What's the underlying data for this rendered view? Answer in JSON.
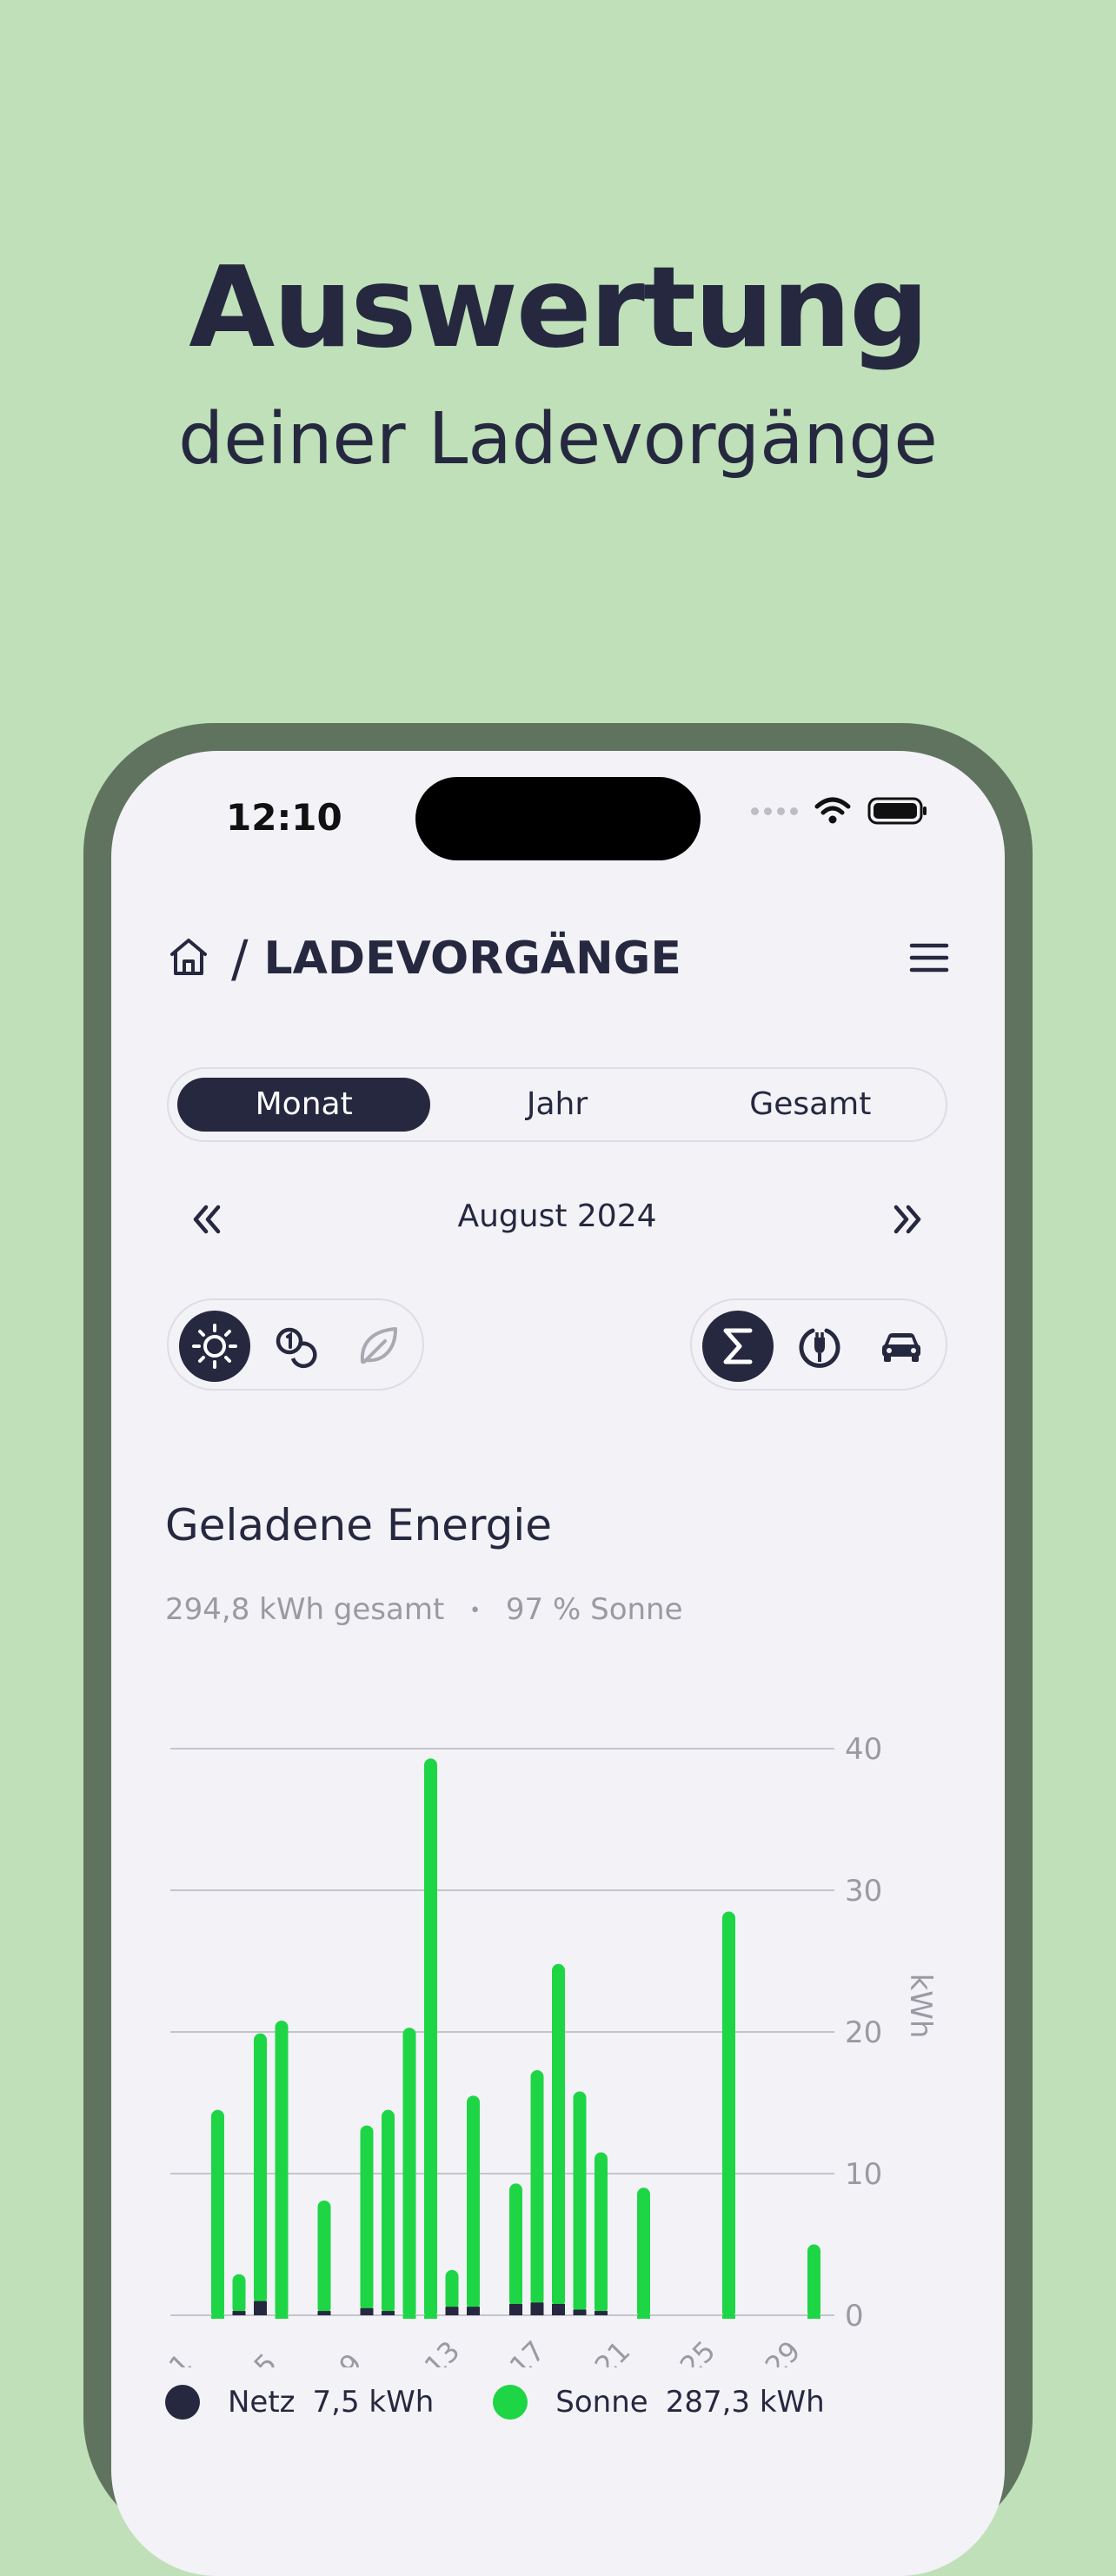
{
  "promo": {
    "headline": "Auswertung",
    "subline": "deiner Ladevorgänge"
  },
  "status_bar": {
    "time": "12:10"
  },
  "nav": {
    "home_icon": "home-icon",
    "separator": "/",
    "title": "LADEVORGÄNGE",
    "menu_icon": "hamburger-menu-icon"
  },
  "period_tabs": [
    {
      "label": "Monat",
      "active": true
    },
    {
      "label": "Jahr",
      "active": false
    },
    {
      "label": "Gesamt",
      "active": false
    }
  ],
  "month_nav": {
    "label": "August 2024",
    "prev_icon": "double-chevron-left-icon",
    "next_icon": "double-chevron-right-icon"
  },
  "metric_toggle": [
    {
      "icon": "sun-icon",
      "active": true
    },
    {
      "icon": "coins-icon",
      "active": false
    },
    {
      "icon": "leaf-icon",
      "active": false
    }
  ],
  "group_toggle": [
    {
      "icon": "sigma-icon",
      "active": true
    },
    {
      "icon": "charger-plug-icon",
      "active": false
    },
    {
      "icon": "car-icon",
      "active": false
    }
  ],
  "chart_section": {
    "title": "Geladene Energie",
    "summary_total": "294,8 kWh gesamt",
    "summary_dot": "•",
    "summary_share": "97 % Sonne"
  },
  "legend": [
    {
      "label": "Netz",
      "value": "7,5 kWh",
      "color": "#262840"
    },
    {
      "label": "Sonne",
      "value": "287,3 kWh",
      "color": "#1ed645"
    }
  ],
  "colors": {
    "sun": "#1ed645",
    "grid": "#262840",
    "accent_dark": "#262840",
    "background": "#bfe0b8"
  },
  "chart_data": {
    "type": "bar",
    "stacked": true,
    "title": "",
    "xlabel": "",
    "ylabel": "kWh",
    "ylim": [
      0,
      40
    ],
    "yticks": [
      0,
      10,
      20,
      30,
      40
    ],
    "xticks": [
      "1",
      "5",
      "9",
      "13",
      "17",
      "21",
      "25",
      "29"
    ],
    "x": [
      1,
      2,
      3,
      4,
      5,
      6,
      7,
      8,
      9,
      10,
      11,
      12,
      13,
      14,
      15,
      16,
      17,
      18,
      19,
      20,
      21,
      22,
      23,
      24,
      25,
      26,
      27,
      28,
      29,
      30,
      31
    ],
    "y_axis_side": "right",
    "grid": true,
    "series": [
      {
        "name": "Netz",
        "values": [
          0,
          0,
          0.3,
          1.0,
          0,
          0,
          0.3,
          0,
          0.5,
          0.3,
          0,
          0,
          0.6,
          0.6,
          0,
          0.8,
          0.9,
          0.8,
          0.4,
          0.3,
          0,
          0,
          0,
          0,
          0,
          0,
          0,
          0,
          0,
          0,
          0
        ]
      },
      {
        "name": "Sonne",
        "values": [
          0,
          14.5,
          2.6,
          18.9,
          20.8,
          0,
          7.8,
          0,
          12.9,
          14.2,
          20.3,
          39.3,
          2.6,
          14.9,
          0,
          8.5,
          16.4,
          24.0,
          15.4,
          11.2,
          0,
          9.0,
          0,
          0,
          0,
          28.5,
          0,
          0,
          0,
          5.0,
          0
        ]
      }
    ]
  }
}
